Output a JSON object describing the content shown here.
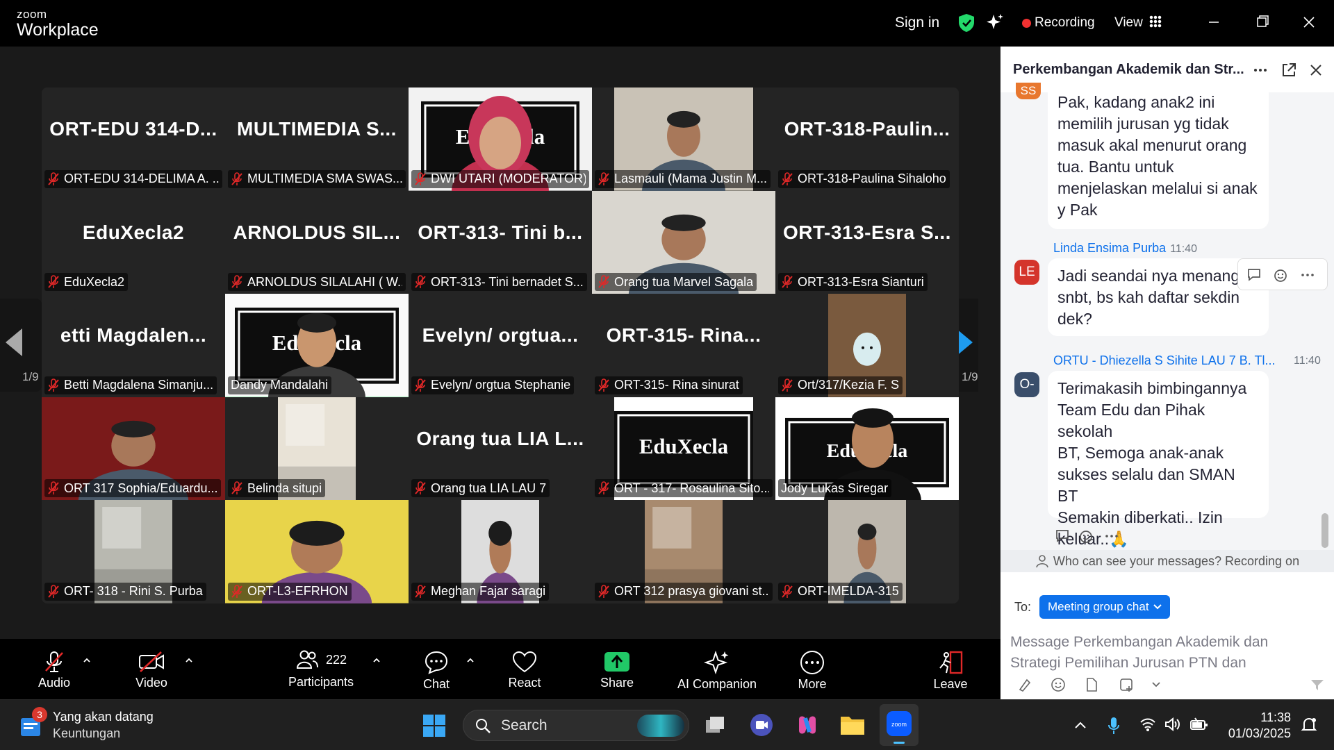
{
  "titlebar": {
    "logo_top": "zoom",
    "logo_bottom": "Workplace",
    "signin": "Sign in",
    "recording": "Recording",
    "view": "View"
  },
  "stage": {
    "page_left": "1/9",
    "page_right": "1/9"
  },
  "tiles": [
    {
      "big": "ORT-EDU 314-D...",
      "name": "ORT-EDU 314-DELIMA A. ..."
    },
    {
      "big": "MULTIMEDIA S...",
      "name": "MULTIMEDIA SMA SWAS..."
    },
    {
      "big": "",
      "name": "DWI UTARI (MODERATOR)"
    },
    {
      "big": "",
      "name": "Lasmauli (Mama Justin M..."
    },
    {
      "big": "ORT-318-Paulin...",
      "name": "ORT-318-Paulina Sihaloho"
    },
    {
      "big": "EduXecla2",
      "name": "EduXecla2"
    },
    {
      "big": "ARNOLDUS SIL...",
      "name": "ARNOLDUS SILALAHI ( W..."
    },
    {
      "big": "ORT-313- Tini b...",
      "name": "ORT-313- Tini bernadet S..."
    },
    {
      "big": "",
      "name": "Orang tua Marvel Sagala"
    },
    {
      "big": "ORT-313-Esra S...",
      "name": "ORT-313-Esra Sianturi"
    },
    {
      "big": "etti Magdalen...",
      "name": "Betti Magdalena Simanju..."
    },
    {
      "big": "",
      "name": "Dandy Mandalahi"
    },
    {
      "big": "Evelyn/ orgtua...",
      "name": "Evelyn/ orgtua Stephanie"
    },
    {
      "big": "ORT-315- Rina...",
      "name": "ORT-315- Rina sinurat"
    },
    {
      "big": "",
      "name": "Ort/317/Kezia F. S"
    },
    {
      "big": "",
      "name": "ORT 317 Sophia/Eduardu..."
    },
    {
      "big": "",
      "name": "Belinda situpi"
    },
    {
      "big": "Orang tua LIA L...",
      "name": "Orang tua LIA LAU 7"
    },
    {
      "big": "",
      "name": "ORT - 317- Rosaulina Sito..."
    },
    {
      "big": "",
      "name": "Jody Lukas Siregar"
    },
    {
      "big": "",
      "name": "ORT- 318 - Rini S. Purba"
    },
    {
      "big": "",
      "name": "ORT-L3-EFRHON"
    },
    {
      "big": "",
      "name": "Meghan Fajar saragi"
    },
    {
      "big": "",
      "name": "ORT 312 prasya giovani st..."
    },
    {
      "big": "",
      "name": "ORT-IMELDA-315"
    }
  ],
  "chat": {
    "title": "Perkembangan Akademik dan Str...",
    "messages": [
      {
        "initials": "SS",
        "color": "#e8772e",
        "sender": "",
        "time": "",
        "text": "Pak, kadang anak2 ini\nmemilih jurusan yg tidak\nmasuk akal menurut orang\ntua. Bantu untuk\nmenjelaskan melalui si anak\ny Pak"
      },
      {
        "initials": "LE",
        "color": "#d4342b",
        "sender": "Linda Ensima Purba",
        "time": "11:40",
        "text": "Jadi seandai nya menang\nsnbt, bs kah daftar sekdin\ndek?"
      },
      {
        "initials": "O-",
        "color": "#3a4e6b",
        "sender": "ORTU - Dhiezella S Sihite LAU 7 B. Tl...",
        "time": "11:40",
        "text": "Terimakasih bimbingannya\nTeam Edu dan Pihak sekolah\nBT, Semoga anak-anak\nsukses selalu dan SMAN BT\nSemakin diberkati.. Izin\nkeluar..🙏"
      }
    ],
    "visibility": "Who can see your messages? Recording on",
    "to_label": "To:",
    "to_target": "Meeting group chat",
    "input_placeholder": "Message Perkembangan Akademik dan Strategi Pemilihan Jurusan PTN dan"
  },
  "toolbar": {
    "audio": "Audio",
    "video": "Video",
    "participants": "Participants",
    "participants_count": "222",
    "chat": "Chat",
    "react": "React",
    "share": "Share",
    "ai": "AI Companion",
    "more": "More",
    "leave": "Leave"
  },
  "taskbar": {
    "widget_badge": "3",
    "widget_title": "Yang akan datang",
    "widget_sub": "Keuntungan",
    "search_placeholder": "Search",
    "time": "11:38",
    "date": "01/03/2025"
  }
}
